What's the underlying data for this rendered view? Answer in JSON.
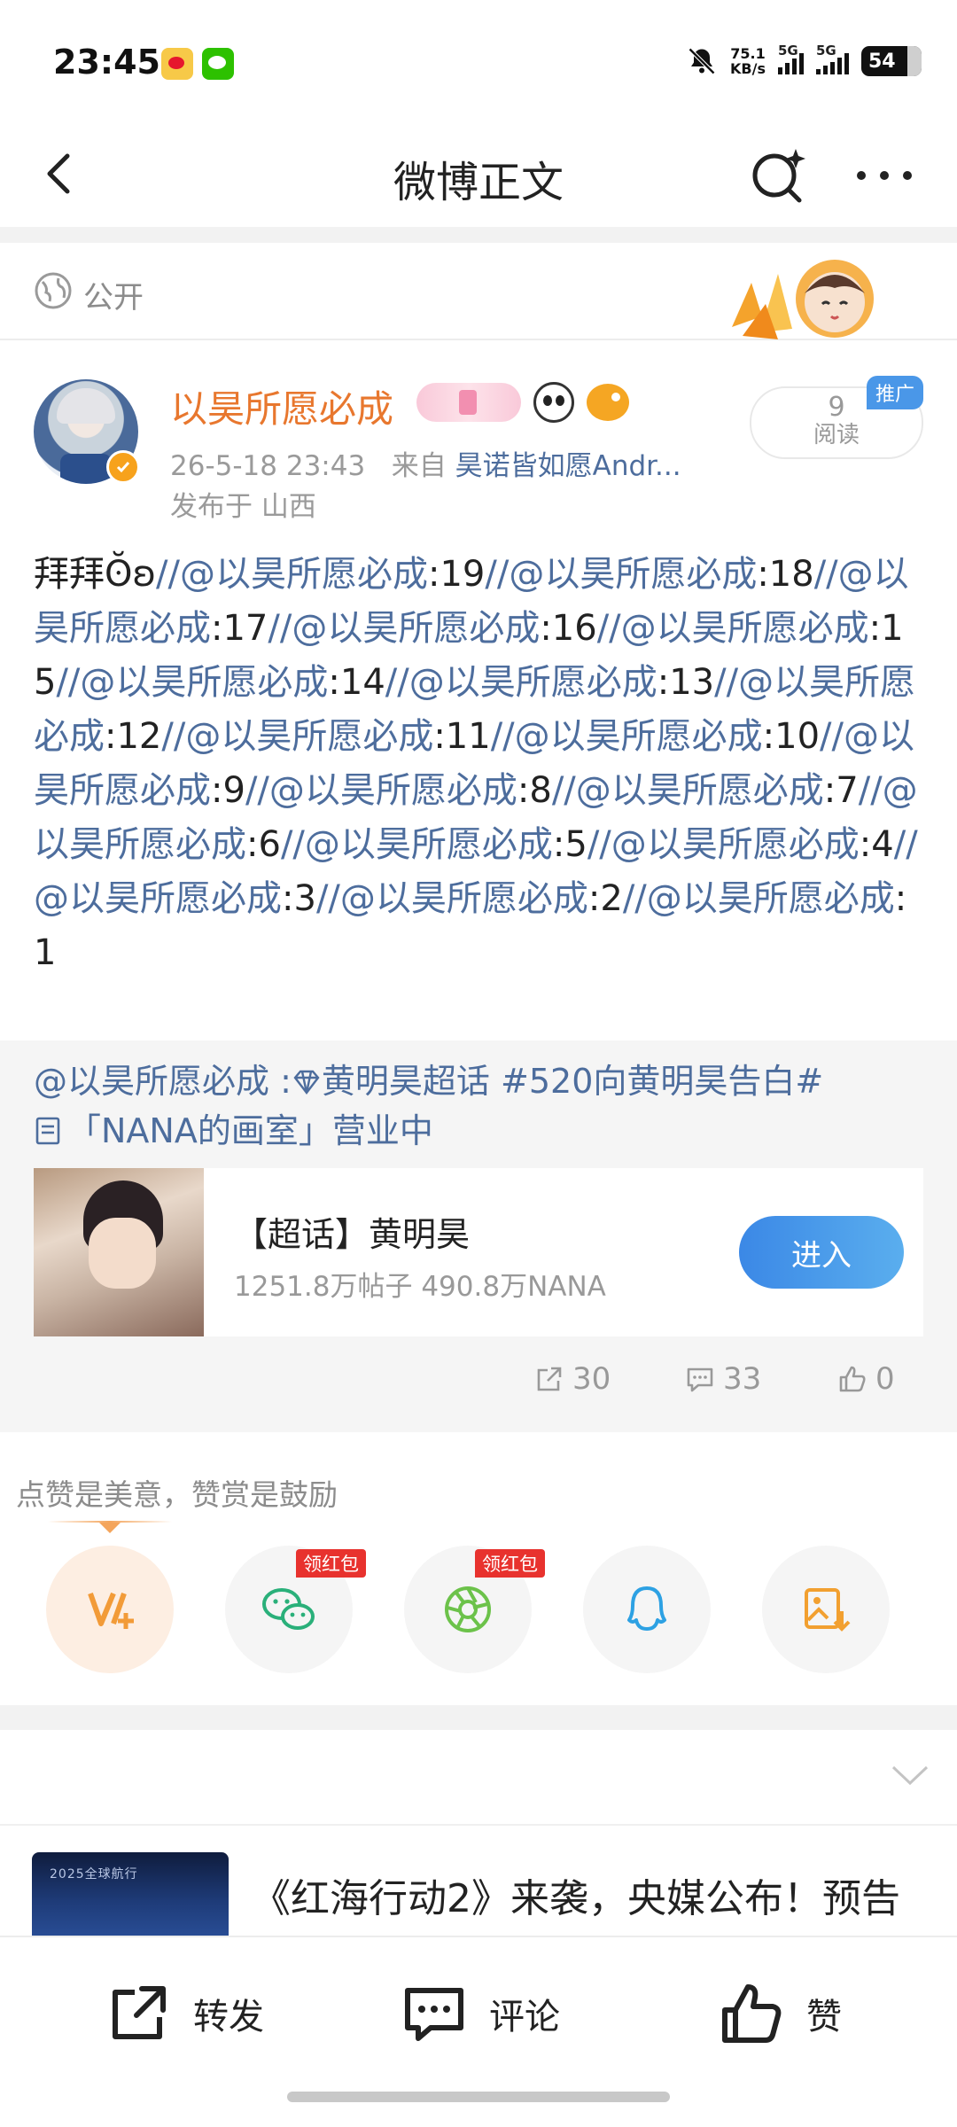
{
  "status_bar": {
    "time": "23:45",
    "speed_value": "75.1",
    "speed_unit": "KB/s",
    "signal1": "5G",
    "signal2": "5G",
    "battery": "54"
  },
  "nav": {
    "title": "微博正文"
  },
  "visibility": {
    "label": "公开"
  },
  "post": {
    "username": "以昊所愿必成",
    "timestamp": "26-5-18 23:43",
    "source_prefix": "来自",
    "source": "昊诺皆如愿Andr...",
    "location": "发布于 山西",
    "read_count": "9",
    "read_label": "阅读",
    "promo_tag": "推广",
    "body_lead": "拜拜ʘ̆ʚ",
    "mention": "@以昊所愿必成",
    "chain": [
      {
        "sep": "//",
        "mention": "@以昊所愿必成",
        "num": ":19"
      },
      {
        "sep": "//",
        "mention": "@以昊所愿必成",
        "num": ":18"
      },
      {
        "sep": "//",
        "mention": "@以昊所愿必成",
        "num": ":17"
      },
      {
        "sep": "//",
        "mention": "@以昊所愿必成",
        "num": ":16"
      },
      {
        "sep": "//",
        "mention": "@以昊所愿必成",
        "num": ":15"
      },
      {
        "sep": "//",
        "mention": "@以昊所愿必成",
        "num": ":14"
      },
      {
        "sep": "//",
        "mention": "@以昊所愿必成",
        "num": ":13"
      },
      {
        "sep": "//",
        "mention": "@以昊所愿必成",
        "num": ":12"
      },
      {
        "sep": "//",
        "mention": "@以昊所愿必成",
        "num": ":11"
      },
      {
        "sep": "//",
        "mention": "@以昊所愿必成",
        "num": ":10"
      },
      {
        "sep": "//",
        "mention": "@以昊所愿必成",
        "num": ":9"
      },
      {
        "sep": "//",
        "mention": "@以昊所愿必成",
        "num": ":8"
      },
      {
        "sep": "//",
        "mention": "@以昊所愿必成",
        "num": ":7"
      },
      {
        "sep": "//",
        "mention": "@以昊所愿必成",
        "num": ":6"
      },
      {
        "sep": "//",
        "mention": "@以昊所愿必成",
        "num": ":5"
      },
      {
        "sep": "//",
        "mention": "@以昊所愿必成",
        "num": ":4"
      },
      {
        "sep": "//",
        "mention": "@以昊所愿必成",
        "num": ":3"
      },
      {
        "sep": "//",
        "mention": "@以昊所愿必成",
        "num": ":2"
      },
      {
        "sep": "//",
        "mention": "@以昊所愿必成",
        "num": ":1"
      }
    ]
  },
  "repost": {
    "author": "@以昊所愿必成",
    "sep": " :",
    "supertopic": "黄明昊超话",
    "hashtag": " #520向黄明昊告白#",
    "studio_line": "「NANA的画室」营业中",
    "topic_title": "【超话】黄明昊",
    "topic_stats": "1251.8万帖子 490.8万NANA",
    "enter_label": "进入",
    "share_count": "30",
    "comment_count": "33",
    "like_count": "0"
  },
  "reward": {
    "text": "点赞是美意，赞赏是鼓励",
    "red_packet_1": "领红包",
    "red_packet_2": "领红包",
    "icons": [
      "reward-icon",
      "wechat-icon",
      "moments-icon",
      "qq-icon",
      "save-image-icon"
    ]
  },
  "feed": {
    "thumb_caption": "2025全球航行",
    "news_title": "《红海行动2》来袭，央媒公布！预告"
  },
  "bottom_bar": {
    "repost_label": "转发",
    "comment_label": "评论",
    "like_label": "赞"
  },
  "colors": {
    "mention_blue": "#4d6d9d",
    "username_orange": "#e8772e",
    "enter_blue": "#3b88e6",
    "red_packet": "#e8322e"
  }
}
